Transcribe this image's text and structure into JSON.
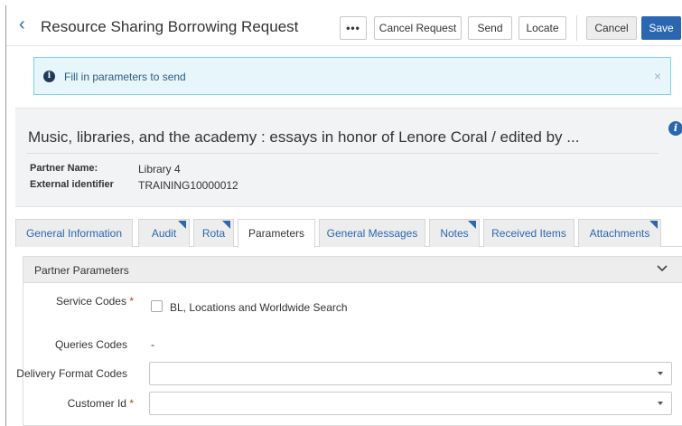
{
  "header": {
    "title": "Resource Sharing Borrowing Request",
    "more_label": "•••",
    "cancel_request_label": "Cancel Request",
    "send_label": "Send",
    "locate_label": "Locate",
    "cancel_label": "Cancel",
    "save_label": "Save"
  },
  "alert": {
    "message": "Fill in parameters to send",
    "close": "×"
  },
  "record": {
    "title": "Music, libraries, and the academy : essays in honor of Lenore Coral / edited by ...",
    "partner_name_label": "Partner Name:",
    "partner_name_value": "Library 4",
    "external_id_label": "External identifier",
    "external_id_value": "TRAINING10000012"
  },
  "tabs": [
    {
      "label": "General Information"
    },
    {
      "label": "Audit"
    },
    {
      "label": "Rota"
    },
    {
      "label": "Parameters"
    },
    {
      "label": "General Messages"
    },
    {
      "label": "Notes"
    },
    {
      "label": "Received Items"
    },
    {
      "label": "Attachments"
    }
  ],
  "panel": {
    "title": "Partner Parameters",
    "fields": {
      "service_codes_label": "Service Codes",
      "service_codes_option": "BL, Locations and Worldwide Search",
      "queries_codes_label": "Queries Codes",
      "queries_codes_value": "-",
      "delivery_format_label": "Delivery Format Codes",
      "customer_id_label": "Customer Id",
      "required_mark": "*"
    }
  },
  "colors": {
    "accent": "#2b67b0",
    "alert_bg": "#e6f6fa",
    "required": "#d0342c"
  }
}
